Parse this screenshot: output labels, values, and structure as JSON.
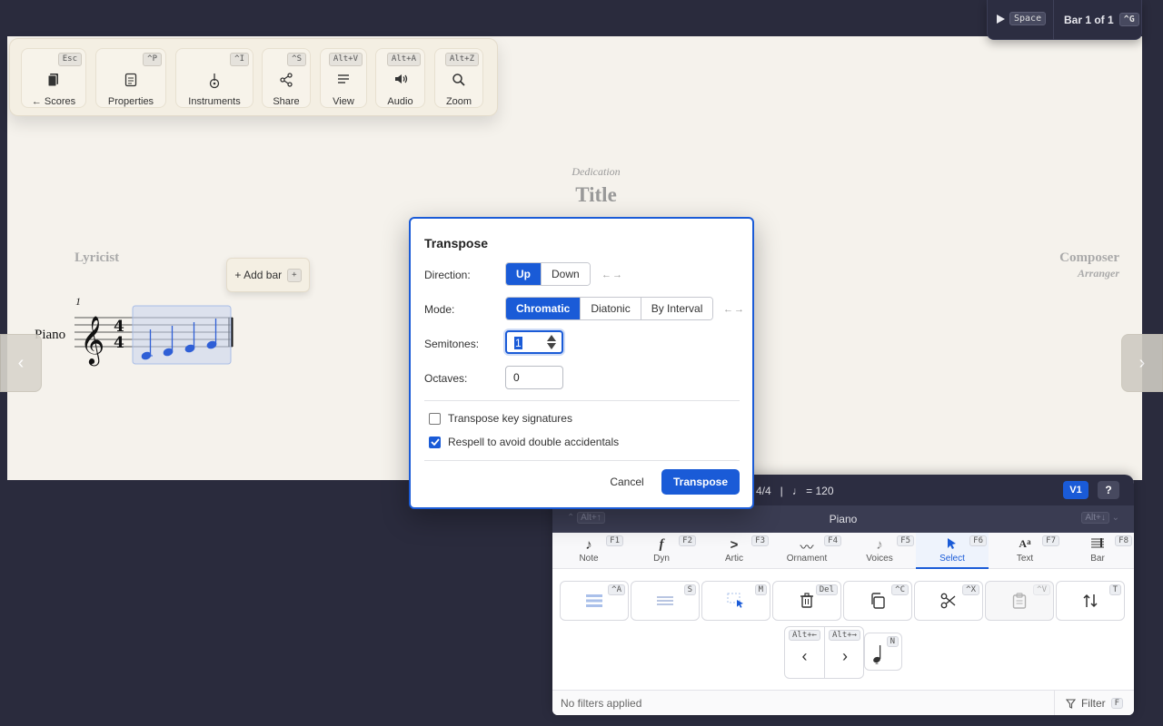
{
  "toolbar": {
    "buttons": [
      {
        "label": "← Scores",
        "key": "Esc",
        "icon": "scores-icon"
      },
      {
        "label": "Properties",
        "key": "^P",
        "icon": "properties-icon"
      },
      {
        "label": "Instruments",
        "key": "^I",
        "icon": "instruments-icon"
      },
      {
        "label": "Share",
        "key": "^S",
        "icon": "share-icon"
      },
      {
        "label": "View",
        "key": "Alt+V",
        "icon": "view-icon"
      },
      {
        "label": "Audio",
        "key": "Alt+A",
        "icon": "audio-icon"
      },
      {
        "label": "Zoom",
        "key": "Alt+Z",
        "icon": "zoom-icon"
      }
    ]
  },
  "playback": {
    "play_key": "Space",
    "bar_text": "Bar 1 of 1",
    "bar_key": "^G"
  },
  "score": {
    "dedication": "Dedication",
    "title": "Title",
    "lyricist": "Lyricist",
    "composer": "Composer",
    "arranger": "Arranger",
    "instrument": "Piano",
    "bar_number": "1",
    "add_bar": "+ Add bar",
    "add_bar_key": "+",
    "note_color": "#2f5fd6"
  },
  "dialog": {
    "title": "Transpose",
    "direction_label": "Direction:",
    "direction_options": [
      "Up",
      "Down"
    ],
    "direction_selected": "Up",
    "mode_label": "Mode:",
    "mode_options": [
      "Chromatic",
      "Diatonic",
      "By Interval"
    ],
    "mode_selected": "Chromatic",
    "semitones_label": "Semitones:",
    "semitones_value": "1",
    "octaves_label": "Octaves:",
    "octaves_value": "0",
    "transpose_key_sigs": "Transpose key signatures",
    "respell": "Respell to avoid double accidentals",
    "cancel": "Cancel",
    "submit": "Transpose",
    "accent": "#1a5bd7"
  },
  "bottom_panel": {
    "meter": "4/4   |   ♩ = 120",
    "voice": "V1",
    "help": "?",
    "prev_inst_key": "Alt+↑",
    "next_inst_key": "Alt+↓",
    "instrument": "Piano",
    "tabs": [
      {
        "label": "Note",
        "key": "F1"
      },
      {
        "label": "Dyn",
        "key": "F2"
      },
      {
        "label": "Artic",
        "key": "F3"
      },
      {
        "label": "Ornament",
        "key": "F4"
      },
      {
        "label": "Voices",
        "key": "F5"
      },
      {
        "label": "Select",
        "key": "F6"
      },
      {
        "label": "Text",
        "key": "F7"
      },
      {
        "label": "Bar",
        "key": "F8"
      }
    ],
    "active_tab": "Select",
    "tools": [
      {
        "icon": "select-all-icon",
        "key": "^A"
      },
      {
        "icon": "select-staff-icon",
        "key": "S"
      },
      {
        "icon": "marquee-select-icon",
        "key": "M"
      },
      {
        "icon": "delete-icon",
        "key": "Del"
      },
      {
        "icon": "copy-icon",
        "key": "^C"
      },
      {
        "icon": "cut-icon",
        "key": "^X"
      },
      {
        "icon": "paste-icon",
        "key": "^V"
      },
      {
        "icon": "transpose-icon",
        "key": "T"
      }
    ],
    "prev_key": "Alt+←",
    "next_key": "Alt+→",
    "note_key": "N",
    "filter_status": "No filters applied",
    "filter_label": "Filter",
    "filter_key": "F"
  }
}
